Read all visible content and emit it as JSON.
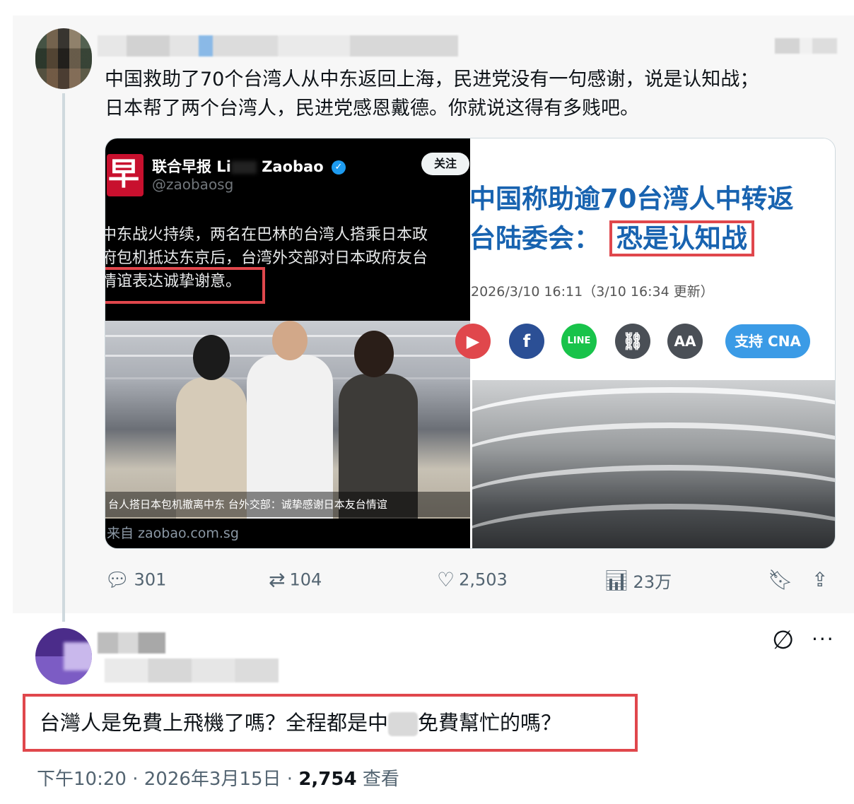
{
  "parent_tweet": {
    "text_line1": "中国救助了70个台湾人从中东返回上海，民进党没有一句感谢，说是认知战；",
    "text_line2": "日本帮了两个台湾人，民进党感恩戴德。你就说这得有多贱吧。",
    "media_left": {
      "logo_glyph": "早",
      "account_name_a": "联合早报 Li",
      "account_name_b": " Zaobao",
      "handle": "@zaobaosg",
      "follow_label": "关注",
      "body": "中东战火持续，两名在巴林的台湾人搭乘日本政\n府包机抵达东京后，台湾外交部对日本政府友台\n情谊表达诚挚谢意。",
      "caption": "台人搭日本包机撤离中东 台外交部：诚挚感谢日本友台情谊",
      "source": "来自 zaobao.com.sg"
    },
    "media_right": {
      "headline_line1": "中国称助逾70台湾人中转返",
      "headline_line2_a": "台陆委会：",
      "headline_line2_b": "恐是认知战",
      "date": "2026/3/10 16:11（3/10 16:34 更新）",
      "support_label": "支持 CNA",
      "font_size_label": "AA"
    },
    "actions": {
      "replies": "301",
      "retweets": "104",
      "likes": "2,503",
      "views": "23万"
    }
  },
  "reply_tweet": {
    "text_a": "台灣人是免費上飛機了嗎？全程都是中",
    "text_b": "免費幫忙的嗎？",
    "time": "下午10:20",
    "date": "2026年3月15日",
    "views_count": "2,754",
    "views_label": "查看"
  },
  "colors": {
    "highlight_box": "#e0474c",
    "cna_blue": "#1863b0",
    "muted_text": "#536471"
  }
}
